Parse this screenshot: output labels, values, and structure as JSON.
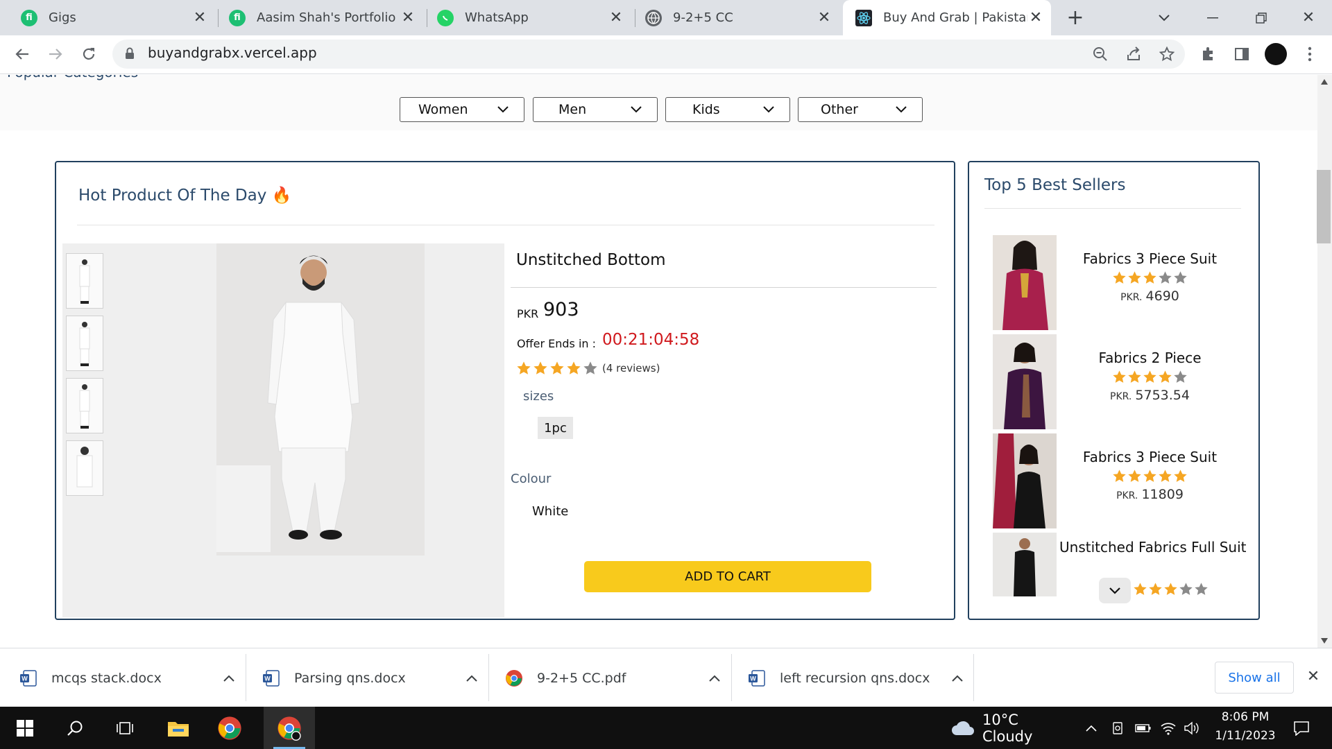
{
  "tabs": [
    {
      "title": "Gigs",
      "icon": "fiverr-icon",
      "active": false
    },
    {
      "title": "Aasim Shah's Portfolio",
      "icon": "fiverr-icon",
      "active": false
    },
    {
      "title": "WhatsApp",
      "icon": "whatsapp-icon",
      "active": false
    },
    {
      "title": "9-2+5 CC",
      "icon": "globe-icon",
      "active": false
    },
    {
      "title": "Buy And Grab | Pakistan's",
      "icon": "react-icon",
      "active": true
    }
  ],
  "address_bar": {
    "url": "buyandgrabx.vercel.app"
  },
  "page": {
    "categories_heading": "Popular Categories",
    "categories": [
      "Women",
      "Men",
      "Kids",
      "Other"
    ],
    "hot_product": {
      "heading": "Hot Product Of The Day",
      "heading_emoji": "🔥",
      "name": "Unstitched Bottom",
      "currency": "PKR",
      "price": "903",
      "offer_label": "Offer Ends in :",
      "timer": "00:21:04:58",
      "rating": 4,
      "reviews": "(4 reviews)",
      "sizes_label": "sizes",
      "sizes": [
        "1pc"
      ],
      "colour_label": "Colour",
      "colour_value": "White",
      "cart_button": "ADD TO CART"
    },
    "best_sellers": {
      "heading": "Top 5 Best Sellers",
      "items": [
        {
          "name": "Fabrics 3 Piece Suit",
          "rating": 3,
          "currency": "PKR.",
          "price": "4690"
        },
        {
          "name": "Fabrics 2 Piece",
          "rating": 4,
          "currency": "PKR.",
          "price": "5753.54"
        },
        {
          "name": "Fabrics 3 Piece Suit",
          "rating": 5,
          "currency": "PKR.",
          "price": "11809"
        },
        {
          "name": "Unstitched Fabrics Full Suit",
          "rating": 3,
          "currency": "",
          "price": ""
        }
      ]
    }
  },
  "downloads": {
    "items": [
      {
        "name": "mcqs stack.docx",
        "icon": "word-icon"
      },
      {
        "name": "Parsing qns.docx",
        "icon": "word-icon"
      },
      {
        "name": "9-2+5 CC.pdf",
        "icon": "chrome-icon"
      },
      {
        "name": "left recursion qns.docx",
        "icon": "word-icon"
      }
    ],
    "show_all": "Show all"
  },
  "taskbar": {
    "weather": "10°C  Cloudy",
    "time": "8:06 PM",
    "date": "1/11/2023"
  },
  "colors": {
    "accent": "#21405e",
    "cart": "#f8ca1c",
    "timer": "#d0191d",
    "star": "#f5a623"
  }
}
